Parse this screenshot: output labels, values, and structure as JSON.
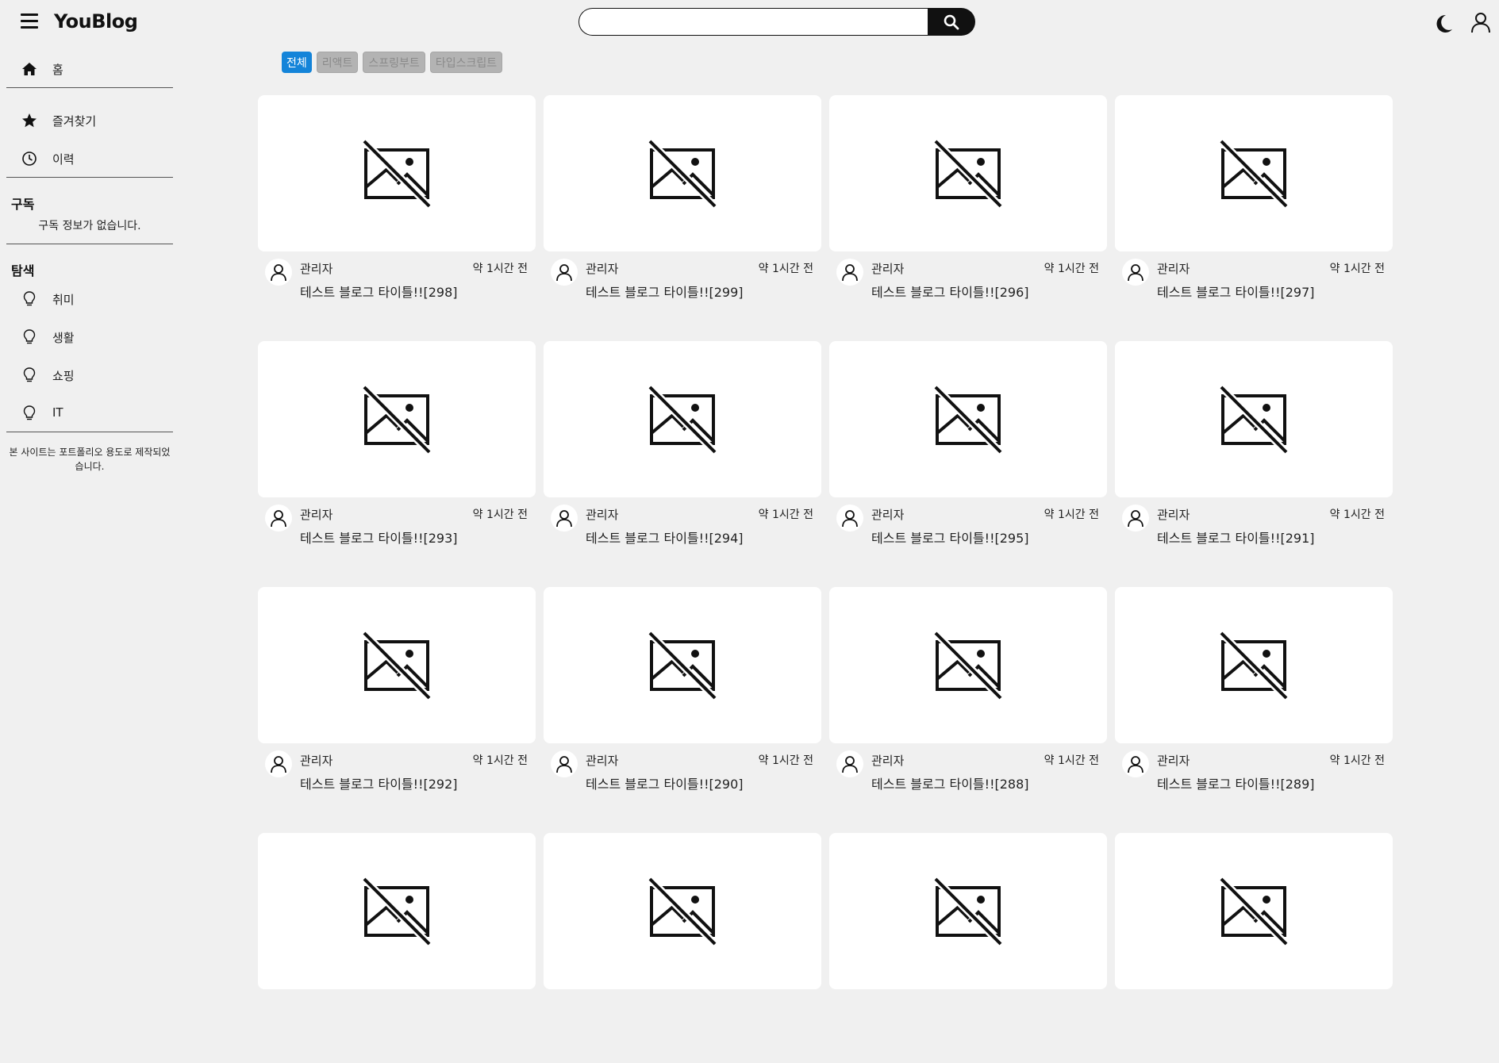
{
  "header": {
    "logo": "YouBlog",
    "search_placeholder": "",
    "icons": {
      "menu": "hamburger-icon",
      "search": "search-icon",
      "theme": "moon-icon",
      "account": "user-icon"
    }
  },
  "sidebar": {
    "top_items": [
      {
        "label": "홈",
        "icon": "home-icon"
      }
    ],
    "library_items": [
      {
        "label": "즐겨찾기",
        "icon": "star-icon"
      },
      {
        "label": "이력",
        "icon": "clock-icon"
      }
    ],
    "subscription": {
      "title": "구독",
      "empty_text": "구독 정보가 없습니다."
    },
    "explore": {
      "title": "탐색",
      "items": [
        {
          "label": "취미",
          "icon": "lightbulb-icon"
        },
        {
          "label": "생활",
          "icon": "lightbulb-icon"
        },
        {
          "label": "쇼핑",
          "icon": "lightbulb-icon"
        },
        {
          "label": "IT",
          "icon": "lightbulb-icon"
        }
      ]
    },
    "footer_note": "본 사이트는 포트폴리오 용도로 제작되었습니다."
  },
  "categories": {
    "chips": [
      {
        "label": "전체",
        "active": true
      },
      {
        "label": "리액트",
        "active": false
      },
      {
        "label": "스프링부트",
        "active": false
      },
      {
        "label": "타입스크립트",
        "active": false
      }
    ],
    "active_color": "#1484d9"
  },
  "posts": [
    {
      "author": "관리자",
      "time": "약 1시간 전",
      "title": "테스트 블로그 타이틀!![298]"
    },
    {
      "author": "관리자",
      "time": "약 1시간 전",
      "title": "테스트 블로그 타이틀!![299]"
    },
    {
      "author": "관리자",
      "time": "약 1시간 전",
      "title": "테스트 블로그 타이틀!![296]"
    },
    {
      "author": "관리자",
      "time": "약 1시간 전",
      "title": "테스트 블로그 타이틀!![297]"
    },
    {
      "author": "관리자",
      "time": "약 1시간 전",
      "title": "테스트 블로그 타이틀!![293]"
    },
    {
      "author": "관리자",
      "time": "약 1시간 전",
      "title": "테스트 블로그 타이틀!![294]"
    },
    {
      "author": "관리자",
      "time": "약 1시간 전",
      "title": "테스트 블로그 타이틀!![295]"
    },
    {
      "author": "관리자",
      "time": "약 1시간 전",
      "title": "테스트 블로그 타이틀!![291]"
    },
    {
      "author": "관리자",
      "time": "약 1시간 전",
      "title": "테스트 블로그 타이틀!![292]"
    },
    {
      "author": "관리자",
      "time": "약 1시간 전",
      "title": "테스트 블로그 타이틀!![290]"
    },
    {
      "author": "관리자",
      "time": "약 1시간 전",
      "title": "테스트 블로그 타이틀!![288]"
    },
    {
      "author": "관리자",
      "time": "약 1시간 전",
      "title": "테스트 블로그 타이틀!![289]"
    },
    {
      "author": "",
      "time": "",
      "title": ""
    },
    {
      "author": "",
      "time": "",
      "title": ""
    },
    {
      "author": "",
      "time": "",
      "title": ""
    },
    {
      "author": "",
      "time": "",
      "title": ""
    }
  ]
}
